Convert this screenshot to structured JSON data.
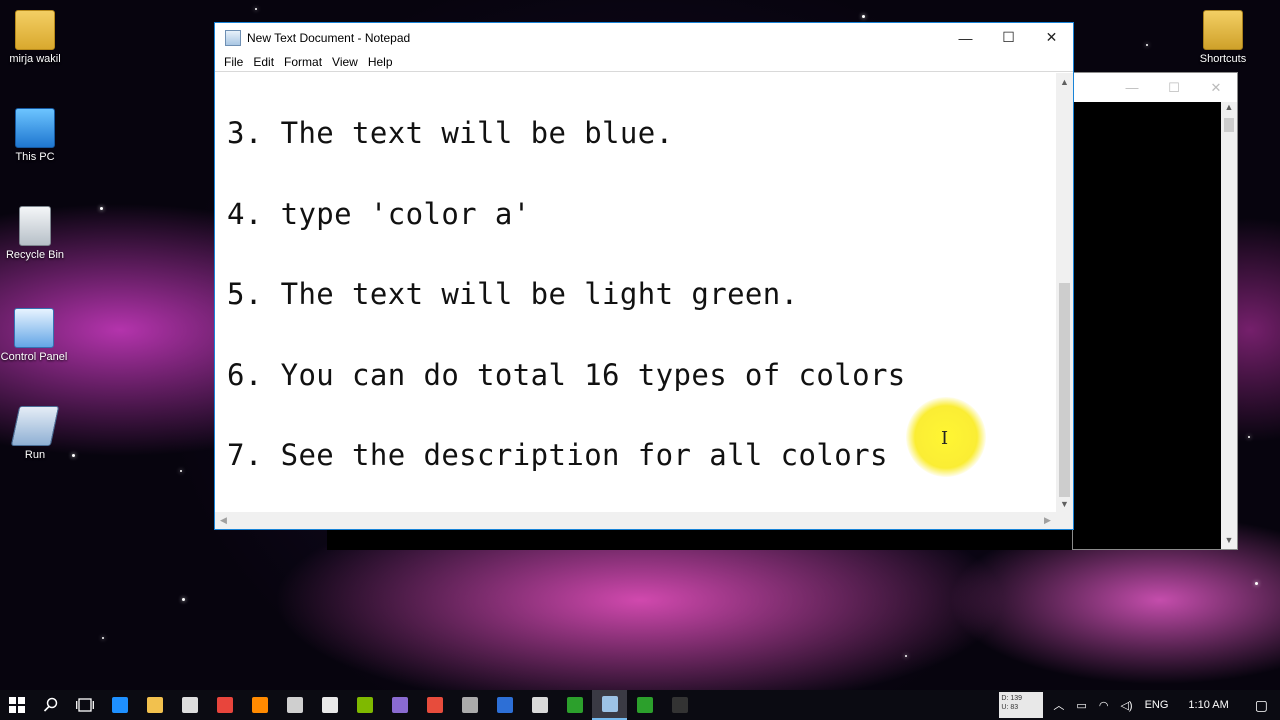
{
  "desktop": {
    "icons": [
      {
        "label": "mirja wakil"
      },
      {
        "label": "This PC"
      },
      {
        "label": "Recycle Bin"
      },
      {
        "label": "Control Panel"
      },
      {
        "label": "Run"
      },
      {
        "label": "Shortcuts"
      }
    ]
  },
  "notepad": {
    "title": "New Text Document - Notepad",
    "menu": [
      "File",
      "Edit",
      "Format",
      "View",
      "Help"
    ],
    "lines": [
      "3. The text will be blue.",
      "4. type 'color a'",
      "5. The text will be light green.",
      "6. You can do total 16 types of colors",
      "7. See the description for all colors"
    ],
    "controls": {
      "minimize": "—",
      "maximize": "☐",
      "close": "✕"
    }
  },
  "console": {
    "controls": {
      "minimize": "—",
      "maximize": "☐",
      "close": "✕"
    }
  },
  "taskbar": {
    "apps": [
      {
        "name": "edge-icon",
        "color": "#1e90ff"
      },
      {
        "name": "file-explorer-icon",
        "color": "#f2c14e"
      },
      {
        "name": "store-icon",
        "color": "#dddddd"
      },
      {
        "name": "chrome-icon",
        "color": "#e8453c"
      },
      {
        "name": "firefox-icon",
        "color": "#ff8a00"
      },
      {
        "name": "app-icon-1",
        "color": "#cfcfcf"
      },
      {
        "name": "notepad-app-icon",
        "color": "#e9e9e9"
      },
      {
        "name": "windows-tiles-icon",
        "color": "#7fb900"
      },
      {
        "name": "app-icon-2",
        "color": "#8a6bd1"
      },
      {
        "name": "app-icon-3",
        "color": "#e74c3c"
      },
      {
        "name": "app-icon-4",
        "color": "#aaaaaa"
      },
      {
        "name": "app-icon-5",
        "color": "#2d6fd6"
      },
      {
        "name": "app-icon-6",
        "color": "#d9d9d9"
      },
      {
        "name": "app-icon-7",
        "color": "#2ca02c"
      },
      {
        "name": "notepad-running-icon",
        "color": "#9cc3e6"
      },
      {
        "name": "app-icon-8",
        "color": "#2ca02c"
      },
      {
        "name": "cmd-icon",
        "color": "#333333"
      }
    ],
    "netmeter": {
      "down": "D: 139",
      "up": "U: 83"
    },
    "language": "ENG",
    "time": "1:10 AM"
  }
}
